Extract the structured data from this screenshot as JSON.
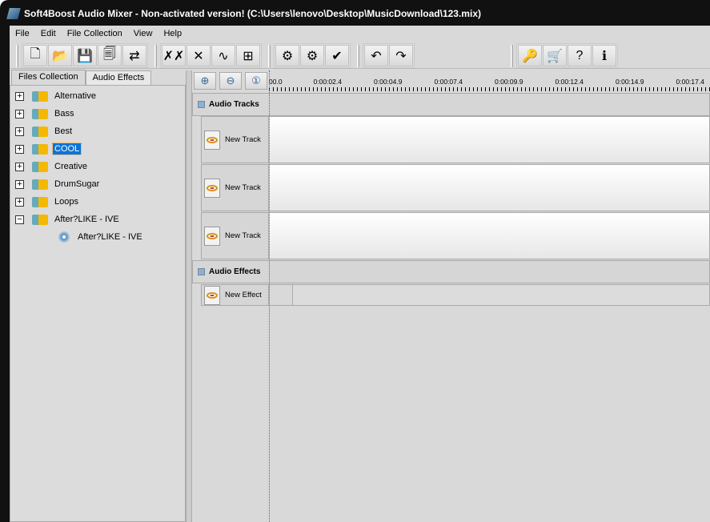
{
  "window": {
    "title": "Soft4Boost Audio Mixer - Non-activated version! (C:\\Users\\lenovo\\Desktop\\MusicDownload\\123.mix)"
  },
  "menu": [
    "File",
    "Edit",
    "File Collection",
    "View",
    "Help"
  ],
  "toolbar": {
    "groups": [
      [
        {
          "name": "new-icon",
          "g": "🗋"
        },
        {
          "name": "open-folder-icon",
          "g": "📂"
        },
        {
          "name": "save-icon",
          "g": "💾"
        },
        {
          "name": "save-as-icon",
          "g": "🗐"
        },
        {
          "name": "export-icon",
          "g": "⇄"
        }
      ],
      [
        {
          "name": "delete-all-icon",
          "g": "✗✗"
        },
        {
          "name": "delete-icon",
          "g": "✕"
        },
        {
          "name": "waveform-icon",
          "g": "∿"
        },
        {
          "name": "add-track-icon",
          "g": "⊞"
        }
      ],
      [
        {
          "name": "remove-effect-icon",
          "g": "⚙"
        },
        {
          "name": "effect-settings-icon",
          "g": "⚙"
        },
        {
          "name": "apply-effect-icon",
          "g": "✔"
        }
      ],
      [
        {
          "name": "undo-icon",
          "g": "↶"
        },
        {
          "name": "redo-icon",
          "g": "↷"
        }
      ],
      [
        {
          "name": "key-icon",
          "g": "🔑"
        },
        {
          "name": "cart-icon",
          "g": "🛒"
        },
        {
          "name": "help-icon",
          "g": "?"
        },
        {
          "name": "info-icon",
          "g": "ℹ"
        }
      ]
    ]
  },
  "left_panel": {
    "tabs": [
      "Files Collection",
      "Audio Effects"
    ],
    "active_tab": 0,
    "tree": [
      {
        "label": "Alternative",
        "expanded": false
      },
      {
        "label": "Bass",
        "expanded": false
      },
      {
        "label": "Best",
        "expanded": false
      },
      {
        "label": "COOL",
        "expanded": false,
        "selected": true
      },
      {
        "label": "Creative",
        "expanded": false
      },
      {
        "label": "DrumSugar",
        "expanded": false
      },
      {
        "label": "Loops",
        "expanded": false
      },
      {
        "label": "After?LIKE - IVE",
        "expanded": true,
        "children": [
          "After?LIKE - IVE"
        ]
      }
    ]
  },
  "timeline": {
    "ruler": [
      "00.0",
      "0:00:02.4",
      "0:00:04.9",
      "0:00:07.4",
      "0:00:09.9",
      "0:00:12.4",
      "0:00:14.9",
      "0:00:17.4"
    ],
    "audio_tracks_label": "Audio Tracks",
    "tracks": [
      "New Track",
      "New Track",
      "New Track"
    ],
    "audio_effects_label": "Audio Effects",
    "effects": [
      "New Effect"
    ]
  },
  "colors": {
    "selection": "#0a74da",
    "playhead": "#00aa00"
  }
}
